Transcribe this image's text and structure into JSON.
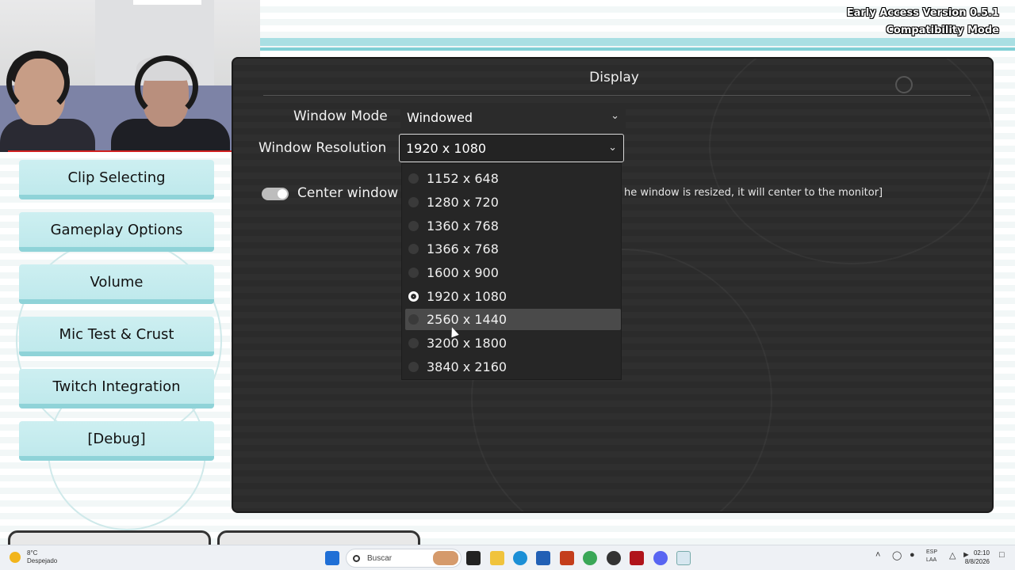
{
  "game": {
    "version_line1": "Early Access Version 0.5.1",
    "version_line2": "Compatibility Mode"
  },
  "sidebar": {
    "items": [
      {
        "label": "Clip Selecting"
      },
      {
        "label": "Gameplay Options"
      },
      {
        "label": "Volume"
      },
      {
        "label": "Mic Test & Crust"
      },
      {
        "label": "Twitch Integration"
      },
      {
        "label": "[Debug]"
      }
    ]
  },
  "display": {
    "title": "Display",
    "window_mode_label": "Window Mode",
    "window_mode_value": "Windowed",
    "resolution_label": "Window Resolution",
    "resolution_value": "1920 x 1080",
    "center_label": "Center window",
    "center_hint": "he window is resized, it will center to the monitor]",
    "center_enabled": true
  },
  "resolution_options": [
    {
      "label": "1152 x 648",
      "selected": false,
      "hover": false
    },
    {
      "label": "1280 x 720",
      "selected": false,
      "hover": false
    },
    {
      "label": "1360 x 768",
      "selected": false,
      "hover": false
    },
    {
      "label": "1366 x 768",
      "selected": false,
      "hover": false
    },
    {
      "label": "1600 x 900",
      "selected": false,
      "hover": false
    },
    {
      "label": "1920 x 1080",
      "selected": true,
      "hover": false
    },
    {
      "label": "2560 x 1440",
      "selected": false,
      "hover": true
    },
    {
      "label": "3200 x 1800",
      "selected": false,
      "hover": false
    },
    {
      "label": "3840 x 2160",
      "selected": false,
      "hover": false
    }
  ],
  "taskbar": {
    "weather_temp": "8°C",
    "weather_desc": "Despejado",
    "search_placeholder": "Buscar",
    "lang_line1": "ESP",
    "lang_line2": "LAA",
    "time": "02:10",
    "date": "8/8/2026"
  },
  "colors": {
    "sidebar_button": "#bfe9ec",
    "panel_bg": "#2b2b2b",
    "accent_teal": "#8fd3d8"
  }
}
